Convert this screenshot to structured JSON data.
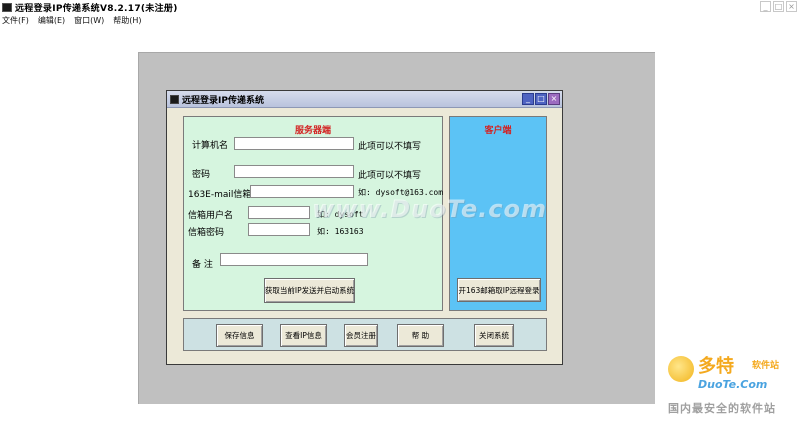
{
  "app": {
    "title": "远程登录IP传递系统V8.2.17(未注册)",
    "window_controls": [
      "_",
      "□",
      "×"
    ]
  },
  "menu": [
    {
      "label": "文件(F)"
    },
    {
      "label": "编辑(E)"
    },
    {
      "label": "窗口(W)"
    },
    {
      "label": "帮助(H)"
    }
  ],
  "child_window": {
    "title": "远程登录IP传递系统",
    "controls": [
      "_",
      "□",
      "×"
    ]
  },
  "server": {
    "header": "服务器端",
    "computer_name": {
      "label": "计算机名",
      "value": "",
      "hint": "此项可以不填写"
    },
    "password": {
      "label": "密码",
      "value": "",
      "hint": "此项可以不填写"
    },
    "email": {
      "label": "163E-mail信箱",
      "value": "",
      "hint": "如: dysoft@163.com"
    },
    "mail_user": {
      "label": "信箱用户名",
      "value": "",
      "hint": "如: dysoft"
    },
    "mail_password": {
      "label": "信箱密码",
      "value": "",
      "hint": "如: 163163"
    },
    "remark": {
      "label": "备  注",
      "value": ""
    },
    "start_button": "获取当前IP发送并启动系统"
  },
  "client": {
    "header": "客户端",
    "open_button": "开163邮箱取IP远程登录"
  },
  "bottom_buttons": {
    "save": "保存信息",
    "view_ip": "查看IP信息",
    "register": "会员注册",
    "help": "帮 助",
    "close": "关闭系统"
  },
  "watermark": {
    "center": "www.DuoTe.com",
    "brand_cn": "多特",
    "brand_cn_small": "软件站",
    "brand_en": "DuoTe.Com",
    "slogan": "国内最安全的软件站"
  },
  "colors": {
    "server_panel": "#d6f5df",
    "client_panel": "#5cc3f5",
    "header_red": "#d32222",
    "mdi_background": "#c0c0c0"
  }
}
